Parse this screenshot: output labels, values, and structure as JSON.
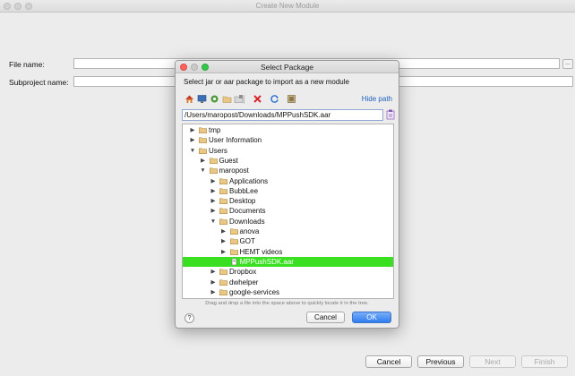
{
  "window": {
    "title": "Create New Module"
  },
  "form": {
    "file_name_label": "File name:",
    "file_name_value": "",
    "browse_label": "...",
    "subproject_label": "Subproject name:",
    "subproject_value": ""
  },
  "wizard_buttons": {
    "cancel": "Cancel",
    "previous": "Previous",
    "next": "Next",
    "finish": "Finish"
  },
  "dialog": {
    "title": "Select Package",
    "instruction": "Select jar or aar package to import as a new module",
    "hide_path": "Hide path",
    "toolbar_icons": [
      "home-icon",
      "desktop-icon",
      "module-icon",
      "folder-icon",
      "new-folder-icon",
      "delete-icon",
      "refresh-icon",
      "show-hidden-icon"
    ],
    "path_value": "/Users/maropost/Downloads/MPPushSDK.aar",
    "tree": [
      {
        "label": "tmp",
        "depth": 0,
        "arrow": "right",
        "type": "folder"
      },
      {
        "label": "User Information",
        "depth": 0,
        "arrow": "right",
        "type": "folder"
      },
      {
        "label": "Users",
        "depth": 0,
        "arrow": "down",
        "type": "folder"
      },
      {
        "label": "Guest",
        "depth": 1,
        "arrow": "right",
        "type": "folder"
      },
      {
        "label": "maropost",
        "depth": 1,
        "arrow": "down",
        "type": "folder"
      },
      {
        "label": "Applications",
        "depth": 2,
        "arrow": "right",
        "type": "folder"
      },
      {
        "label": "BubbLee",
        "depth": 2,
        "arrow": "right",
        "type": "folder"
      },
      {
        "label": "Desktop",
        "depth": 2,
        "arrow": "right",
        "type": "folder"
      },
      {
        "label": "Documents",
        "depth": 2,
        "arrow": "right",
        "type": "folder"
      },
      {
        "label": "Downloads",
        "depth": 2,
        "arrow": "down",
        "type": "folder"
      },
      {
        "label": "anova",
        "depth": 3,
        "arrow": "right",
        "type": "folder"
      },
      {
        "label": "GOT",
        "depth": 3,
        "arrow": "right",
        "type": "folder"
      },
      {
        "label": "HEMT videos",
        "depth": 3,
        "arrow": "right",
        "type": "folder"
      },
      {
        "label": "MPPushSDK.aar",
        "depth": 3,
        "arrow": "none",
        "type": "file",
        "selected": true
      },
      {
        "label": "Dropbox",
        "depth": 2,
        "arrow": "right",
        "type": "folder"
      },
      {
        "label": "dwhelper",
        "depth": 2,
        "arrow": "right",
        "type": "folder"
      },
      {
        "label": "google-services",
        "depth": 2,
        "arrow": "right",
        "type": "folder"
      }
    ],
    "hint": "Drag and drop a file into the space above to quickly locate it in the tree.",
    "help_label": "?",
    "cancel": "Cancel",
    "ok": "OK"
  },
  "colors": {
    "selection": "#3adf22",
    "accent": "#2f7ef0",
    "link": "#1f5fbf",
    "folder": "#e9c886"
  }
}
